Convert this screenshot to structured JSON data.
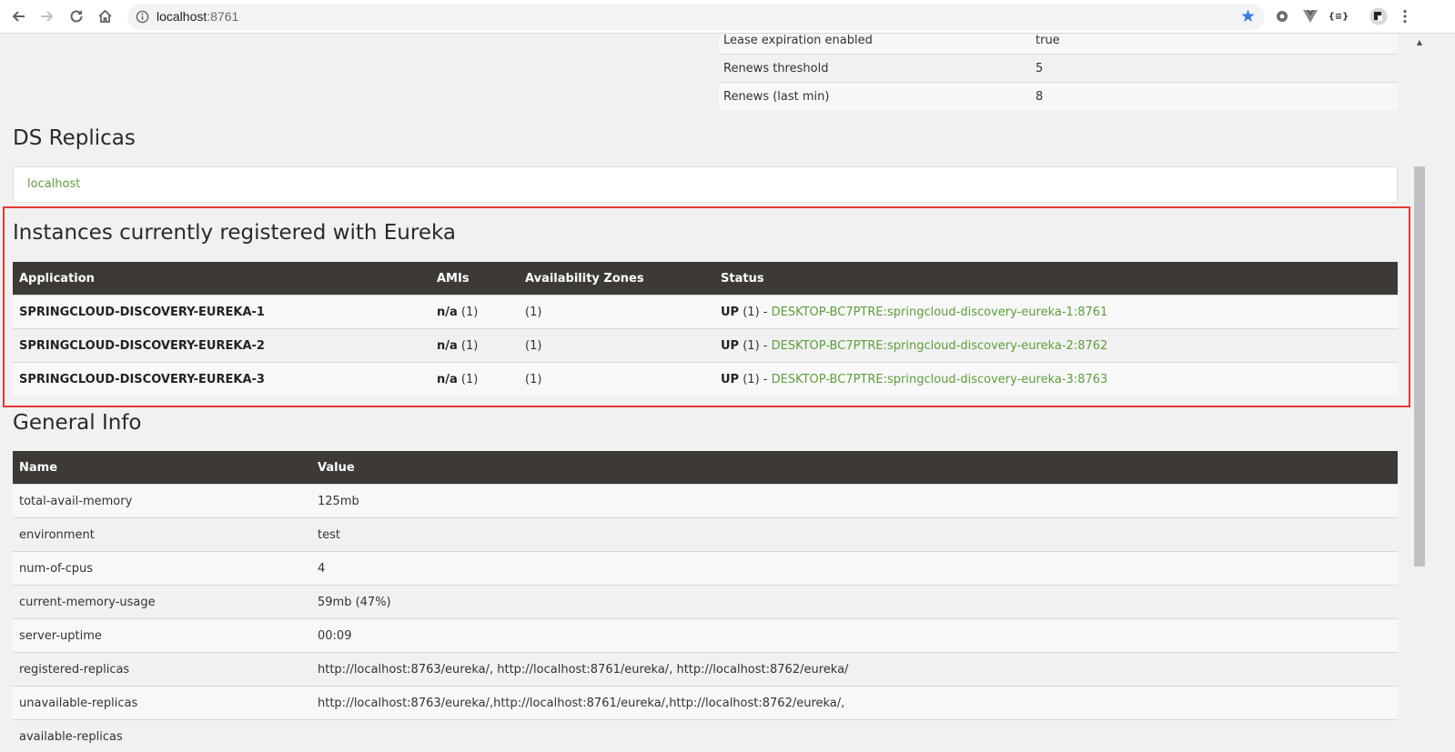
{
  "browser": {
    "url_host": "localhost",
    "url_port": ":8761",
    "colors": {
      "star": "#3b78e7",
      "link": "#5d9e3c",
      "header_bg": "#3d3a35",
      "highlight_border": "#e53935"
    },
    "icons": [
      "back-arrow-icon",
      "forward-arrow-icon",
      "reload-icon",
      "home-icon",
      "info-icon",
      "bookmark-star-icon",
      "extension-gear-icon",
      "extension-vue-icon",
      "extension-json-icon",
      "profile-avatar-icon",
      "menu-kebab-icon"
    ],
    "ext_json_label": "{≡}"
  },
  "lease": {
    "rows": [
      {
        "label": "Lease expiration enabled",
        "value": "true"
      },
      {
        "label": "Renews threshold",
        "value": "5"
      },
      {
        "label": "Renews (last min)",
        "value": "8"
      }
    ]
  },
  "ds_replicas": {
    "heading": "DS Replicas",
    "link": "localhost"
  },
  "instances": {
    "heading": "Instances currently registered with Eureka",
    "headers": [
      "Application",
      "AMIs",
      "Availability Zones",
      "Status"
    ],
    "rows": [
      {
        "app": "SPRINGCLOUD-DISCOVERY-EUREKA-1",
        "ami_bold": "n/a",
        "ami_count": "(1)",
        "zones": "(1)",
        "status_bold": "UP",
        "status_count": "(1) - ",
        "instance_link": "DESKTOP-BC7PTRE:springcloud-discovery-eureka-1:8761"
      },
      {
        "app": "SPRINGCLOUD-DISCOVERY-EUREKA-2",
        "ami_bold": "n/a",
        "ami_count": "(1)",
        "zones": "(1)",
        "status_bold": "UP",
        "status_count": "(1) - ",
        "instance_link": "DESKTOP-BC7PTRE:springcloud-discovery-eureka-2:8762"
      },
      {
        "app": "SPRINGCLOUD-DISCOVERY-EUREKA-3",
        "ami_bold": "n/a",
        "ami_count": "(1)",
        "zones": "(1)",
        "status_bold": "UP",
        "status_count": "(1) - ",
        "instance_link": "DESKTOP-BC7PTRE:springcloud-discovery-eureka-3:8763"
      }
    ]
  },
  "general_info": {
    "heading": "General Info",
    "headers": [
      "Name",
      "Value"
    ],
    "rows": [
      {
        "name": "total-avail-memory",
        "value": "125mb"
      },
      {
        "name": "environment",
        "value": "test"
      },
      {
        "name": "num-of-cpus",
        "value": "4"
      },
      {
        "name": "current-memory-usage",
        "value": "59mb (47%)"
      },
      {
        "name": "server-uptime",
        "value": "00:09"
      },
      {
        "name": "registered-replicas",
        "value": "http://localhost:8763/eureka/, http://localhost:8761/eureka/, http://localhost:8762/eureka/"
      },
      {
        "name": "unavailable-replicas",
        "value": "http://localhost:8763/eureka/,http://localhost:8761/eureka/,http://localhost:8762/eureka/,"
      },
      {
        "name": "available-replicas",
        "value": ""
      }
    ]
  }
}
